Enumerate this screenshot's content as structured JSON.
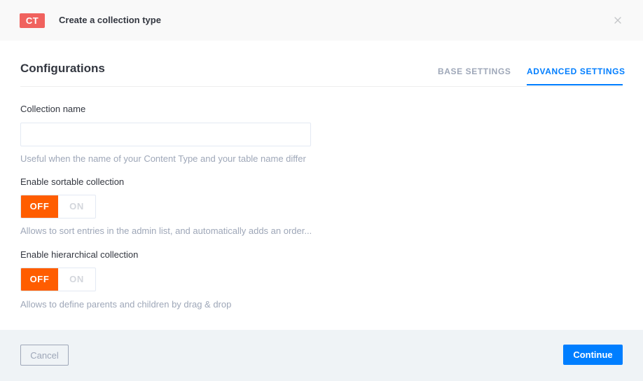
{
  "header": {
    "badge": "CT",
    "title": "Create a collection type",
    "close_icon": "close-icon"
  },
  "section": {
    "title": "Configurations",
    "tabs": [
      {
        "label": "BASE SETTINGS",
        "active": false
      },
      {
        "label": "ADVANCED SETTINGS",
        "active": true
      }
    ]
  },
  "fields": {
    "collection_name": {
      "label": "Collection name",
      "value": "",
      "placeholder": "",
      "hint": "Useful when the name of your Content Type and your table name differ"
    },
    "sortable": {
      "label": "Enable sortable collection",
      "off_label": "OFF",
      "on_label": "ON",
      "selected": "OFF",
      "hint": "Allows to sort entries in the admin list, and automatically adds an order..."
    },
    "hierarchical": {
      "label": "Enable hierarchical collection",
      "off_label": "OFF",
      "on_label": "ON",
      "selected": "OFF",
      "hint": "Allows to define parents and children by drag & drop"
    }
  },
  "footer": {
    "cancel_label": "Cancel",
    "continue_label": "Continue"
  },
  "colors": {
    "badge": "#f0625e",
    "accent": "#007eff",
    "toggle_active": "#ff5d00",
    "muted_text": "#9ea7b8",
    "footer_bg": "#eff3f6"
  }
}
